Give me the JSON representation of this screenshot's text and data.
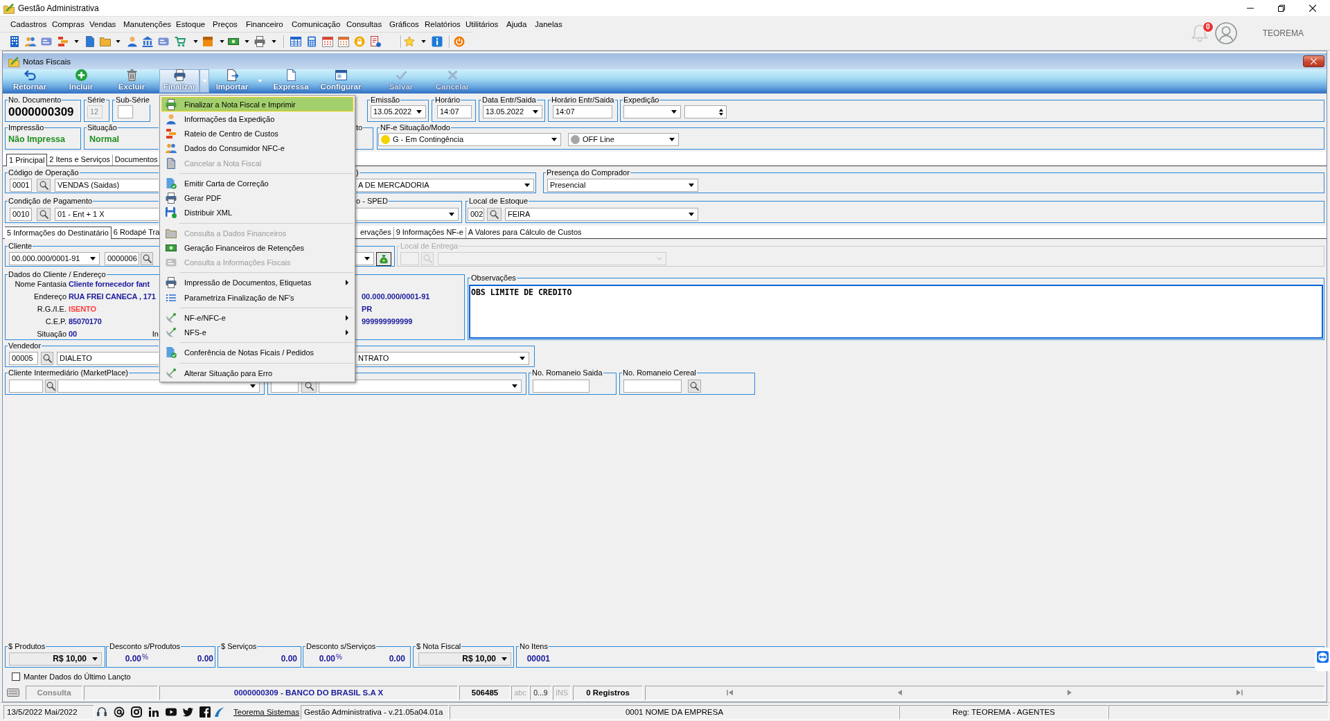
{
  "window": {
    "title": "Gestão Administrativa"
  },
  "menu_bar": [
    "Cadastros",
    "Compras",
    "Vendas",
    "Manutenções",
    "Estoque",
    "Preços",
    "Financeiro",
    "Comunicação",
    "Consultas",
    "Gráficos",
    "Relatórios",
    "Utilitários",
    "Ajuda",
    "Janelas"
  ],
  "user_area": {
    "notifications": "0",
    "user_name": "TEOREMA"
  },
  "document_window": {
    "title": "Notas Fiscais"
  },
  "ribbon": [
    {
      "label": "Retornar",
      "disabled": false,
      "pressed": false,
      "dropdown": false
    },
    {
      "label": "Incluir",
      "disabled": false,
      "pressed": false,
      "dropdown": false
    },
    {
      "label": "Excluir",
      "disabled": false,
      "pressed": false,
      "dropdown": false
    },
    {
      "label": "Finalizar",
      "disabled": false,
      "pressed": true,
      "dropdown": true
    },
    {
      "label": "Importar",
      "disabled": false,
      "pressed": false,
      "dropdown": true
    },
    {
      "label": "Expressa",
      "disabled": false,
      "pressed": false,
      "dropdown": false
    },
    {
      "label": "Configurar",
      "disabled": false,
      "pressed": false,
      "dropdown": false
    },
    {
      "label": "Salvar",
      "disabled": true,
      "pressed": false,
      "dropdown": false
    },
    {
      "label": "Cancelar",
      "disabled": true,
      "pressed": false,
      "dropdown": false
    }
  ],
  "header_rows": [
    [
      {
        "label": "No. Documento",
        "controls": [
          {
            "kind": "doc_number",
            "value": "0000000309"
          }
        ]
      },
      {
        "label": "Série",
        "controls": [
          {
            "kind": "input",
            "value": "12",
            "disabled": true
          }
        ]
      },
      {
        "label": "Sub-Série",
        "controls": [
          {
            "kind": "input"
          }
        ]
      },
      {
        "label": "Emissão",
        "controls": [
          {
            "kind": "combo",
            "value": "13.05.2022"
          }
        ]
      },
      {
        "label": "Horário",
        "controls": [
          {
            "kind": "input",
            "value": "14:07"
          }
        ]
      },
      {
        "label": "Data Entr/Saida",
        "controls": [
          {
            "kind": "combo",
            "value": "13.05.2022"
          }
        ]
      },
      {
        "label": "Horário Entr/Saida",
        "controls": [
          {
            "kind": "input",
            "value": "14:07"
          }
        ]
      },
      {
        "label": "Expedição",
        "controls": [
          {
            "kind": "combo"
          },
          {
            "kind": "spin"
          }
        ]
      }
    ],
    [
      {
        "label": "Impressão",
        "controls": [
          {
            "kind": "status_text",
            "value": "Não Impressa"
          }
        ]
      },
      {
        "label": "Situação",
        "controls": [
          {
            "kind": "status_text",
            "value": "Normal"
          }
        ]
      },
      {
        "label": "to"
      },
      {
        "label": "NF-e Situação/Modo",
        "controls": [
          {
            "kind": "combo",
            "value": "G - Em Contingência",
            "color": "#f2d400"
          },
          {
            "kind": "combo",
            "value": "OFF Line",
            "color": "#a6a6a6"
          }
        ]
      }
    ]
  ],
  "main_tabs": [
    {
      "label": "1 Principal",
      "selected": true
    },
    {
      "label": "2 Itens e Serviços",
      "selected": false
    },
    {
      "label": "Documentos",
      "selected": false
    }
  ],
  "principal_rows": [
    [
      {
        "label": "Código de Operação",
        "controls": [
          {
            "kind": "input",
            "value": "0001"
          },
          {
            "kind": "search"
          },
          {
            "kind": "input",
            "value": "VENDAS (Saidas)"
          }
        ]
      },
      {
        "label": ")",
        "controls": [
          {
            "kind": "combo",
            "value": "A DE MERCADORIA"
          }
        ]
      },
      {
        "label": "Presença do Comprador",
        "controls": [
          {
            "kind": "combo",
            "value": "Presencial"
          }
        ]
      }
    ],
    [
      {
        "label": "Condição de Pagamento",
        "controls": [
          {
            "kind": "input",
            "value": "0010"
          },
          {
            "kind": "search"
          },
          {
            "kind": "input",
            "value": "01 - Ent + 1 X"
          }
        ]
      },
      {
        "label": "o - SPED",
        "controls": [
          {
            "kind": "combo"
          }
        ]
      },
      {
        "label": "Local de Estoque",
        "controls": [
          {
            "kind": "input",
            "value": "002"
          },
          {
            "kind": "search"
          },
          {
            "kind": "combo",
            "value": "FEIRA"
          }
        ]
      }
    ]
  ],
  "detail_tabs": [
    {
      "label": "5 Informações do Destinatário",
      "selected": true
    },
    {
      "label": "6 Rodapé Tra",
      "selected": false
    },
    {
      "label": "ervações",
      "selected": false
    },
    {
      "label": "9 Informações NF-e",
      "selected": false
    },
    {
      "label": "A Valores para Cálculo de Custos",
      "selected": false
    }
  ],
  "recipient": {
    "client_row": [
      {
        "label": "Cliente",
        "disabled": false,
        "controls": [
          {
            "kind": "combo",
            "value": "00.000.000/0001-91"
          },
          {
            "kind": "input",
            "value": "0000006"
          },
          {
            "kind": "search"
          },
          {
            "kind": "combo"
          },
          {
            "kind": "bag_button"
          }
        ]
      },
      {
        "label": "Local de Entrega",
        "disabled": true,
        "controls": [
          {
            "kind": "input",
            "disabled": true
          },
          {
            "kind": "search",
            "disabled": true
          },
          {
            "kind": "combo",
            "disabled": true
          }
        ]
      }
    ],
    "client_data": {
      "label": "Dados do Cliente / Endereço",
      "rows": [
        {
          "label": "Nome Fantasia",
          "value": "Cliente fornecedor fant",
          "color": "#1b1b9e"
        },
        {
          "label": "Endereço",
          "value": "RUA FREI CANECA , 171",
          "color": "#1b1b9e",
          "column_3": "00.000.000/0001-91"
        },
        {
          "label": "R.G./I.E.",
          "value": "ISENTO",
          "color": "#ff3b3b",
          "column_3": "PR"
        },
        {
          "label": "C.E.P.",
          "value": "85070170",
          "color": "#1b1b9e",
          "column_3": "999999999999"
        },
        {
          "label": "Situação",
          "value": "00",
          "color": "#1b1b9e",
          "column_2": "In"
        }
      ]
    },
    "observations": {
      "label": "Observações",
      "value": "OBS LIMITE DE CREDITO"
    },
    "seller_row": [
      {
        "label": "Vendedor",
        "controls": [
          {
            "kind": "input",
            "value": "00005"
          },
          {
            "kind": "search"
          },
          {
            "kind": "input",
            "value": "DIALETO"
          }
        ]
      },
      {
        "controls": [
          {
            "kind": "combo",
            "value": "NTRATO"
          }
        ]
      }
    ],
    "intermediary_row": [
      {
        "label": "Cliente Intermediário (MarketPlace)",
        "controls": [
          {
            "kind": "input"
          },
          {
            "kind": "search"
          },
          {
            "kind": "combo"
          }
        ]
      },
      {
        "controls": [
          {
            "kind": "input"
          },
          {
            "kind": "search"
          },
          {
            "kind": "combo"
          }
        ]
      },
      {
        "label": "No. Romaneio Saida",
        "controls": [
          {
            "kind": "input"
          }
        ]
      },
      {
        "label": "No. Romaneio Cereal",
        "controls": [
          {
            "kind": "input"
          },
          {
            "kind": "search"
          }
        ]
      }
    ]
  },
  "totals": [
    {
      "label": "$ Produtos",
      "controls": [
        {
          "kind": "money_combo",
          "value": "R$ 10,00"
        }
      ]
    },
    {
      "label": "Desconto s/Produtos",
      "controls": [
        {
          "kind": "amount",
          "value": "0.00"
        },
        {
          "kind": "unit",
          "value": "%"
        },
        {
          "kind": "amount",
          "value": "0.00"
        }
      ]
    },
    {
      "label": "$ Serviços",
      "controls": [
        {
          "kind": "amount",
          "value": "0.00"
        }
      ]
    },
    {
      "label": "Desconto s/Serviços",
      "controls": [
        {
          "kind": "amount",
          "value": "0.00"
        },
        {
          "kind": "unit",
          "value": "%"
        },
        {
          "kind": "amount",
          "value": "0.00"
        }
      ]
    },
    {
      "label": "$ Nota Fiscal",
      "controls": [
        {
          "kind": "money_combo",
          "value": "R$ 10,00"
        }
      ]
    },
    {
      "label": "No Itens",
      "controls": [
        {
          "kind": "amount",
          "value": "00001"
        }
      ]
    }
  ],
  "keep_last_entry": {
    "label": "Manter Dados do Último Lançto",
    "checked": false
  },
  "status_row": {
    "mode": "Consulta",
    "record": "0000000309 - BANCO DO BRASIL S.A X",
    "code": "506485",
    "indicators": [
      {
        "label": "abc",
        "on": false
      },
      {
        "label": "0...9",
        "on": true
      },
      {
        "label": "INS",
        "on": false
      }
    ],
    "count": "0 Registros"
  },
  "app_status": {
    "date": "13/5/2022 Mai/2022",
    "link": "Teorema Sistemas",
    "version": "Gestão Administrativa - v.21.05a04.01a",
    "company": "0001 NOME DA EMPRESA",
    "registration": "Reg: TEOREMA - AGENTES"
  },
  "finalize_menu": {
    "items": [
      {
        "kind": "item",
        "label": "Finalizar a Nota Fiscal e Imprimir",
        "selected": true,
        "disabled": false,
        "submenu": false
      },
      {
        "kind": "item",
        "label": "Informações da Expedição",
        "selected": false,
        "disabled": false,
        "submenu": false
      },
      {
        "kind": "item",
        "label": "Rateio de Centro de Custos",
        "selected": false,
        "disabled": false,
        "submenu": false
      },
      {
        "kind": "item",
        "label": "Dados do Consumidor NFC-e",
        "selected": false,
        "disabled": false,
        "submenu": false
      },
      {
        "kind": "item",
        "label": "Cancelar a Nota Fiscal",
        "selected": false,
        "disabled": true,
        "submenu": false
      },
      {
        "kind": "separator"
      },
      {
        "kind": "item",
        "label": "Emitir Carta de Correção",
        "selected": false,
        "disabled": false,
        "submenu": false
      },
      {
        "kind": "item",
        "label": "Gerar PDF",
        "selected": false,
        "disabled": false,
        "submenu": false
      },
      {
        "kind": "item",
        "label": "Distribuir XML",
        "selected": false,
        "disabled": false,
        "submenu": false
      },
      {
        "kind": "separator"
      },
      {
        "kind": "item",
        "label": "Consulta a Dados Financeiros",
        "selected": false,
        "disabled": true,
        "submenu": false
      },
      {
        "kind": "item",
        "label": "Geração Financeiros de Retenções",
        "selected": false,
        "disabled": false,
        "submenu": false
      },
      {
        "kind": "item",
        "label": "Consulta a Informações Fiscais",
        "selected": false,
        "disabled": true,
        "submenu": false
      },
      {
        "kind": "separator"
      },
      {
        "kind": "item",
        "label": "Impressão de Documentos, Etiquetas",
        "selected": false,
        "disabled": false,
        "submenu": true
      },
      {
        "kind": "item",
        "label": "Parametriza Finalização de NF's",
        "selected": false,
        "disabled": false,
        "submenu": false
      },
      {
        "kind": "separator"
      },
      {
        "kind": "item",
        "label": "NF-e/NFC-e",
        "selected": false,
        "disabled": false,
        "submenu": true
      },
      {
        "kind": "item",
        "label": "NFS-e",
        "selected": false,
        "disabled": false,
        "submenu": true
      },
      {
        "kind": "separator"
      },
      {
        "kind": "item",
        "label": "Conferência de Notas Ficais / Pedidos",
        "selected": false,
        "disabled": false,
        "submenu": false
      },
      {
        "kind": "separator"
      },
      {
        "kind": "item",
        "label": "Alterar Situação para Erro",
        "selected": false,
        "disabled": false,
        "submenu": false
      }
    ]
  }
}
